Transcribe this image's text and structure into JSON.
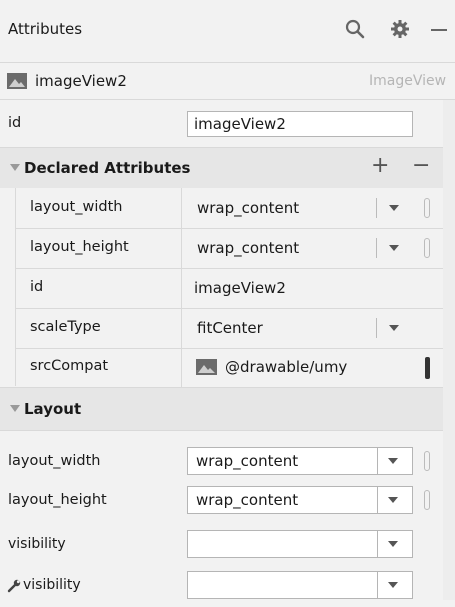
{
  "header": {
    "title": "Attributes",
    "icons": [
      "search-icon",
      "gear-icon",
      "minimize-icon"
    ]
  },
  "component": {
    "name": "imageView2",
    "type": "ImageView"
  },
  "id_row": {
    "label": "id",
    "value": "imageView2"
  },
  "declared": {
    "title": "Declared Attributes",
    "add": "+",
    "remove": "−",
    "rows": [
      {
        "label": "layout_width",
        "value": "wrap_content"
      },
      {
        "label": "layout_height",
        "value": "wrap_content"
      },
      {
        "label": "id",
        "value": "imageView2"
      },
      {
        "label": "scaleType",
        "value": "fitCenter"
      },
      {
        "label": "srcCompat",
        "value": "@drawable/umy"
      }
    ]
  },
  "layout": {
    "title": "Layout",
    "rows": [
      {
        "label": "layout_width",
        "value": "wrap_content"
      },
      {
        "label": "layout_height",
        "value": "wrap_content"
      },
      {
        "label": "visibility",
        "value": ""
      },
      {
        "label": "visibility",
        "value": ""
      }
    ]
  },
  "colors": {
    "background": "#f2f2f2",
    "section": "#e6e6e6",
    "border": "#b5b5b5"
  }
}
